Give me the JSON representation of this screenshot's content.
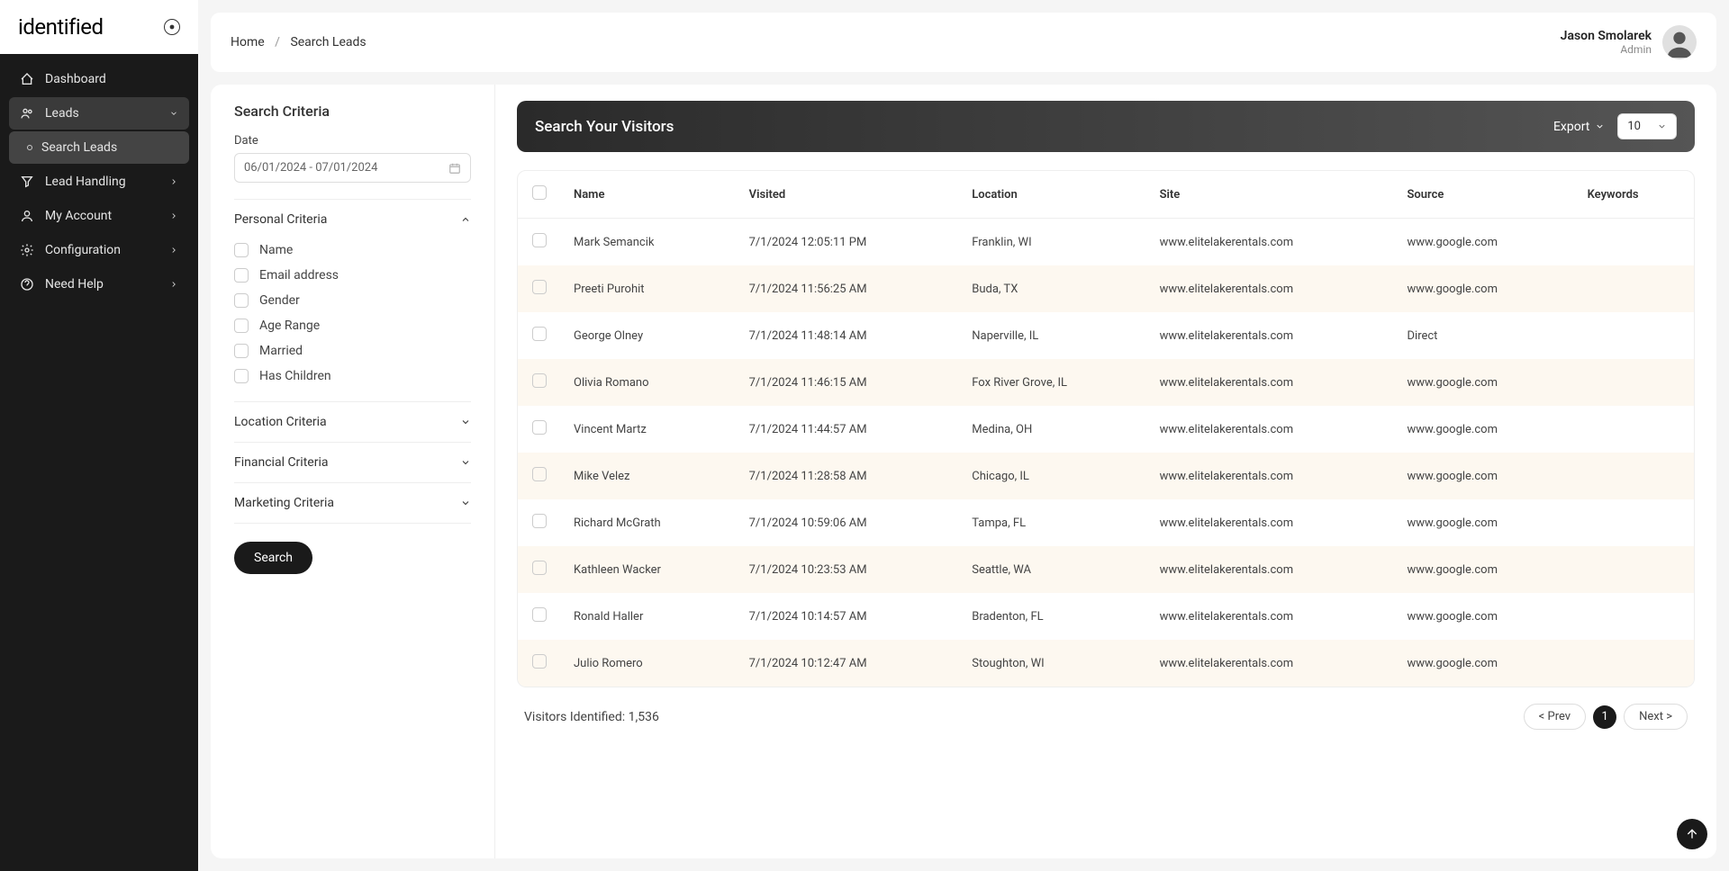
{
  "brand": "identified",
  "sidebar": {
    "items": [
      {
        "icon": "home-icon",
        "label": "Dashboard",
        "expandable": false
      },
      {
        "icon": "users-icon",
        "label": "Leads",
        "expandable": true,
        "active": true
      },
      {
        "icon": "dot-icon",
        "label": "Search Leads",
        "sub": true
      },
      {
        "icon": "filter-icon",
        "label": "Lead Handling",
        "expandable": true
      },
      {
        "icon": "user-icon",
        "label": "My Account",
        "expandable": true
      },
      {
        "icon": "gear-icon",
        "label": "Configuration",
        "expandable": true
      },
      {
        "icon": "help-icon",
        "label": "Need Help",
        "expandable": true
      }
    ]
  },
  "breadcrumb": {
    "home": "Home",
    "current": "Search Leads"
  },
  "user": {
    "name": "Jason Smolarek",
    "role": "Admin"
  },
  "criteria": {
    "title": "Search Criteria",
    "date_label": "Date",
    "date_value": "06/01/2024 - 07/01/2024",
    "sections": [
      {
        "label": "Personal Criteria",
        "open": true,
        "options": [
          "Name",
          "Email address",
          "Gender",
          "Age Range",
          "Married",
          "Has Children"
        ]
      },
      {
        "label": "Location Criteria",
        "open": false
      },
      {
        "label": "Financial Criteria",
        "open": false
      },
      {
        "label": "Marketing Criteria",
        "open": false
      }
    ],
    "search_btn": "Search"
  },
  "results": {
    "title": "Search Your Visitors",
    "export_label": "Export",
    "page_size": "10",
    "columns": [
      "Name",
      "Visited",
      "Location",
      "Site",
      "Source",
      "Keywords"
    ],
    "rows": [
      {
        "name": "Mark Semancik",
        "visited": "7/1/2024 12:05:11 PM",
        "location": "Franklin, WI",
        "site": "www.elitelakerentals.com",
        "source": "www.google.com",
        "keywords": ""
      },
      {
        "name": "Preeti Purohit",
        "visited": "7/1/2024 11:56:25 AM",
        "location": "Buda, TX",
        "site": "www.elitelakerentals.com",
        "source": "www.google.com",
        "keywords": ""
      },
      {
        "name": "George Olney",
        "visited": "7/1/2024 11:48:14 AM",
        "location": "Naperville, IL",
        "site": "www.elitelakerentals.com",
        "source": "Direct",
        "keywords": ""
      },
      {
        "name": "Olivia Romano",
        "visited": "7/1/2024 11:46:15 AM",
        "location": "Fox River Grove, IL",
        "site": "www.elitelakerentals.com",
        "source": "www.google.com",
        "keywords": ""
      },
      {
        "name": "Vincent Martz",
        "visited": "7/1/2024 11:44:57 AM",
        "location": "Medina, OH",
        "site": "www.elitelakerentals.com",
        "source": "www.google.com",
        "keywords": ""
      },
      {
        "name": "Mike Velez",
        "visited": "7/1/2024 11:28:58 AM",
        "location": "Chicago, IL",
        "site": "www.elitelakerentals.com",
        "source": "www.google.com",
        "keywords": ""
      },
      {
        "name": "Richard McGrath",
        "visited": "7/1/2024 10:59:06 AM",
        "location": "Tampa, FL",
        "site": "www.elitelakerentals.com",
        "source": "www.google.com",
        "keywords": ""
      },
      {
        "name": "Kathleen Wacker",
        "visited": "7/1/2024 10:23:53 AM",
        "location": "Seattle, WA",
        "site": "www.elitelakerentals.com",
        "source": "www.google.com",
        "keywords": ""
      },
      {
        "name": "Ronald Haller",
        "visited": "7/1/2024 10:14:57 AM",
        "location": "Bradenton, FL",
        "site": "www.elitelakerentals.com",
        "source": "www.google.com",
        "keywords": ""
      },
      {
        "name": "Julio Romero",
        "visited": "7/1/2024 10:12:47 AM",
        "location": "Stoughton, WI",
        "site": "www.elitelakerentals.com",
        "source": "www.google.com",
        "keywords": ""
      }
    ],
    "footer_text": "Visitors Identified: 1,536",
    "prev_label": "< Prev",
    "current_page": "1",
    "next_label": "Next >"
  }
}
